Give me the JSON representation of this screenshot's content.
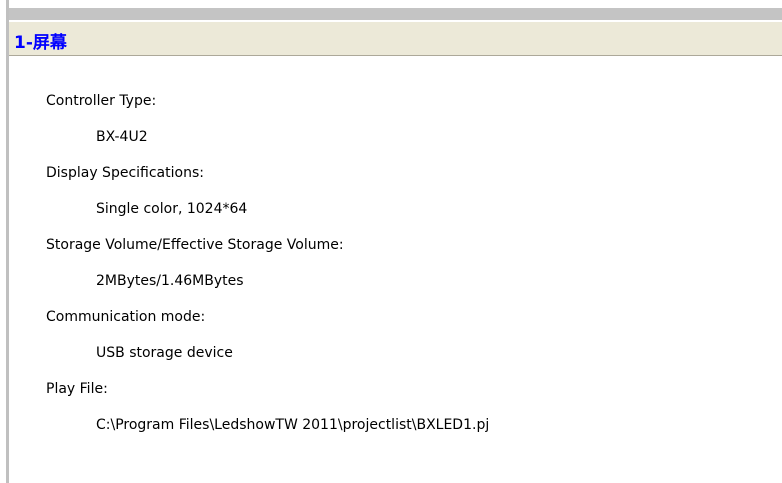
{
  "header": {
    "title": "1-屏幕"
  },
  "properties": [
    {
      "label": "Controller Type:",
      "value": "BX-4U2"
    },
    {
      "label": "Display Specifications:",
      "value": "Single color, 1024*64"
    },
    {
      "label": "Storage Volume/Effective Storage Volume:",
      "value": "2MBytes/1.46MBytes"
    },
    {
      "label": "Communication mode:",
      "value": "USB storage device"
    },
    {
      "label": "Play File:",
      "value": "C:\\Program Files\\LedshowTW 2011\\projectlist\\BXLED1.pj"
    }
  ],
  "colors": {
    "title_text": "#0000ff",
    "header_bg": "#ece9d8",
    "border": "#c0c0c0"
  }
}
